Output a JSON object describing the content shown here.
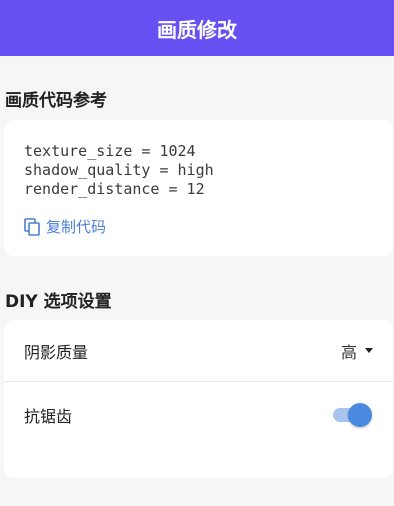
{
  "header": {
    "title": "画质修改"
  },
  "code_section": {
    "title": "画质代码参考",
    "lines": [
      "texture_size = 1024",
      "shadow_quality = high",
      "render_distance = 12"
    ],
    "copy_label": "复制代码",
    "copy_icon": "copy-icon"
  },
  "diy_section": {
    "title": "DIY 选项设置",
    "quality": {
      "label": "阴影质量",
      "selected": "高"
    },
    "antialias": {
      "label": "抗锯齿",
      "enabled": true
    }
  },
  "colors": {
    "header_bg": "#6750f2",
    "accent": "#4a8ae0",
    "link": "#4a7fd4"
  }
}
